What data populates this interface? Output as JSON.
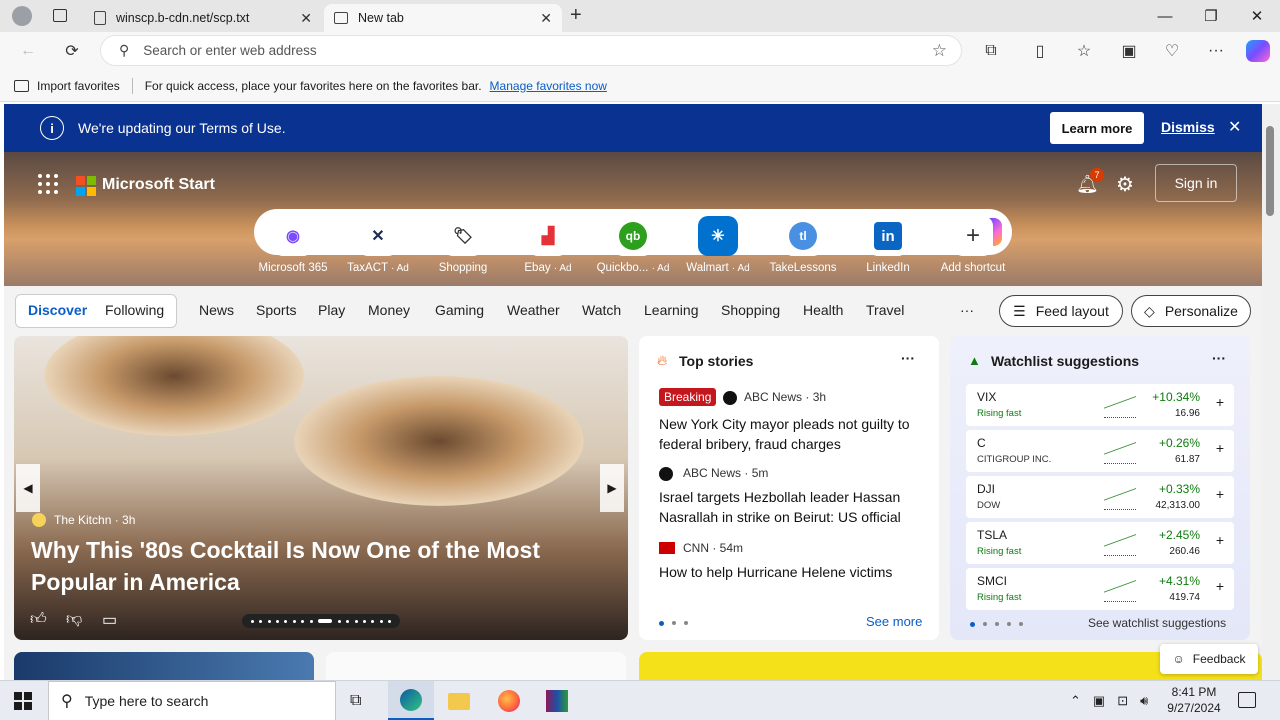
{
  "browser": {
    "tabs": [
      {
        "title": "winscp.b-cdn.net/scp.txt"
      },
      {
        "title": "New tab"
      }
    ],
    "address_placeholder": "Search or enter web address"
  },
  "favorites_bar": {
    "import_label": "Import favorites",
    "hint": "For quick access, place your favorites here on the favorites bar.",
    "manage_link": "Manage favorites now"
  },
  "banner": {
    "message": "We're updating our Terms of Use.",
    "learn_more": "Learn more",
    "dismiss": "Dismiss"
  },
  "header": {
    "brand": "Microsoft Start",
    "notification_count": "7",
    "sign_in": "Sign in"
  },
  "shortcuts": [
    {
      "label": "Microsoft 365",
      "ad": ""
    },
    {
      "label": "TaxACT",
      "ad": "· Ad"
    },
    {
      "label": "Shopping",
      "ad": ""
    },
    {
      "label": "Ebay",
      "ad": "· Ad"
    },
    {
      "label": "Quickbo...",
      "ad": "· Ad"
    },
    {
      "label": "Walmart",
      "ad": "· Ad"
    },
    {
      "label": "TakeLessons",
      "ad": ""
    },
    {
      "label": "LinkedIn",
      "ad": ""
    },
    {
      "label": "Add shortcut",
      "ad": ""
    }
  ],
  "feed_nav": {
    "discover": "Discover",
    "following": "Following",
    "categories": [
      "News",
      "Sports",
      "Play",
      "Money",
      "Gaming",
      "Weather",
      "Watch",
      "Learning",
      "Shopping",
      "Health",
      "Travel"
    ],
    "more": "···",
    "feed_layout": "Feed layout",
    "personalize": "Personalize"
  },
  "hero_story": {
    "source": "The Kitchn",
    "age": "· 3h",
    "headline": "Why This '80s Cocktail Is Now One of the Most Popular in America"
  },
  "top_stories": {
    "title": "Top stories",
    "items": [
      {
        "badge": "Breaking",
        "source": "ABC News",
        "age": "· 3h",
        "headline": "New York City mayor pleads not guilty to federal bribery, fraud charges"
      },
      {
        "badge": "",
        "source": "ABC News",
        "age": "· 5m",
        "headline": "Israel targets Hezbollah leader Hassan Nasrallah in strike on Beirut: US official"
      },
      {
        "badge": "",
        "source": "CNN",
        "age": "· 54m",
        "headline": "How to help Hurricane Helene victims"
      }
    ],
    "see_more": "See more"
  },
  "watchlist": {
    "title": "Watchlist suggestions",
    "tickers": [
      {
        "symbol": "VIX",
        "sub": "Rising fast",
        "change": "+10.34%",
        "price": "16.96"
      },
      {
        "symbol": "C",
        "sub": "CITIGROUP INC.",
        "change": "+0.26%",
        "price": "61.87"
      },
      {
        "symbol": "DJI",
        "sub": "DOW",
        "change": "+0.33%",
        "price": "42,313.00"
      },
      {
        "symbol": "TSLA",
        "sub": "Rising fast",
        "change": "+2.45%",
        "price": "260.46"
      },
      {
        "symbol": "SMCI",
        "sub": "Rising fast",
        "change": "+4.31%",
        "price": "419.74"
      }
    ],
    "see_more": "See watchlist suggestions"
  },
  "feedback": "Feedback",
  "taskbar": {
    "search_placeholder": "Type here to search",
    "time": "8:41 PM",
    "date": "9/27/2024"
  },
  "colors": {
    "banner": "#0a3290",
    "accent": "#0a5ec7",
    "positive": "#0f7b0f",
    "breaking": "#c4161c"
  }
}
